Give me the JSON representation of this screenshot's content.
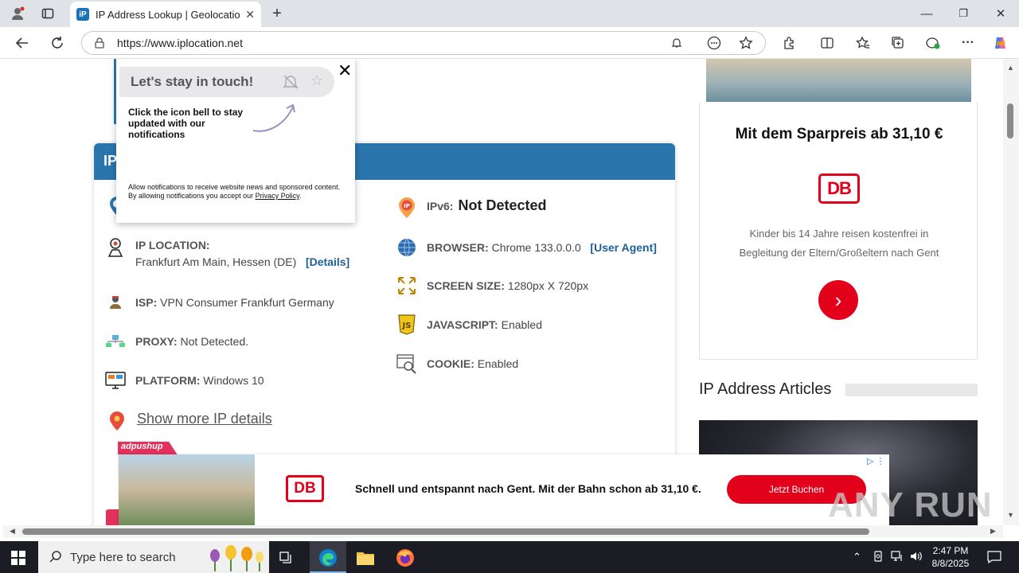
{
  "browser": {
    "tab_title": "IP Address Lookup | Geolocation",
    "tab_favicon": "iP",
    "tab_close": "✕",
    "new_tab": "+",
    "url": "https://www.iplocation.net",
    "win_min": "—",
    "win_restore": "❐",
    "win_close": "✕"
  },
  "panel": {
    "header_fragment": "IP",
    "ipv6_label": "IPv6:",
    "ipv6_value": "Not Detected",
    "location_label": "IP LOCATION:",
    "location_value": "Frankfurt Am Main, Hessen (DE)",
    "location_link": "[Details]",
    "isp_label": "ISP:",
    "isp_value": "VPN Consumer Frankfurt Germany",
    "proxy_label": "PROXY:",
    "proxy_value": "Not Detected.",
    "platform_label": "PLATFORM:",
    "platform_value": "Windows 10",
    "browser_label": "BROWSER:",
    "browser_value": "Chrome 133.0.0.0",
    "browser_link": "[User Agent]",
    "screen_label": "SCREEN SIZE:",
    "screen_value": "1280px X 720px",
    "js_label": "JAVASCRIPT:",
    "js_value": "Enabled",
    "cookie_label": "COOKIE:",
    "cookie_value": "Enabled",
    "show_more": "Show more IP details"
  },
  "popup": {
    "title": "Let's stay in touch!",
    "close": "✕",
    "message": "Click the icon bell to stay updated with our notifications",
    "legal_prefix": "Allow notifications to receive website news and sponsored content. By allowing notifications you accept our",
    "legal_link": "Privacy Policy",
    "legal_suffix": "."
  },
  "right_ad": {
    "headline": "Mit dem Sparpreis ab 31,10 €",
    "logo": "DB",
    "subtext_1": "Kinder bis 14 Jahre reisen kostenfrei in",
    "subtext_2": "Begleitung der Eltern/Großeltern nach Gent",
    "button": "›"
  },
  "articles": {
    "heading": "IP Address Articles"
  },
  "bottom_ad": {
    "tag": "adpushup",
    "logo": "DB",
    "text": "Schnell und entspannt nach Gent. Mit der Bahn schon ab 31,10 €.",
    "button": "Jetzt Buchen",
    "ad_marks": "▷ ⋮"
  },
  "watermark": "ANY RUN",
  "taskbar": {
    "search_placeholder": "Type here to search",
    "time": "2:47 PM",
    "date": "8/8/2025"
  }
}
